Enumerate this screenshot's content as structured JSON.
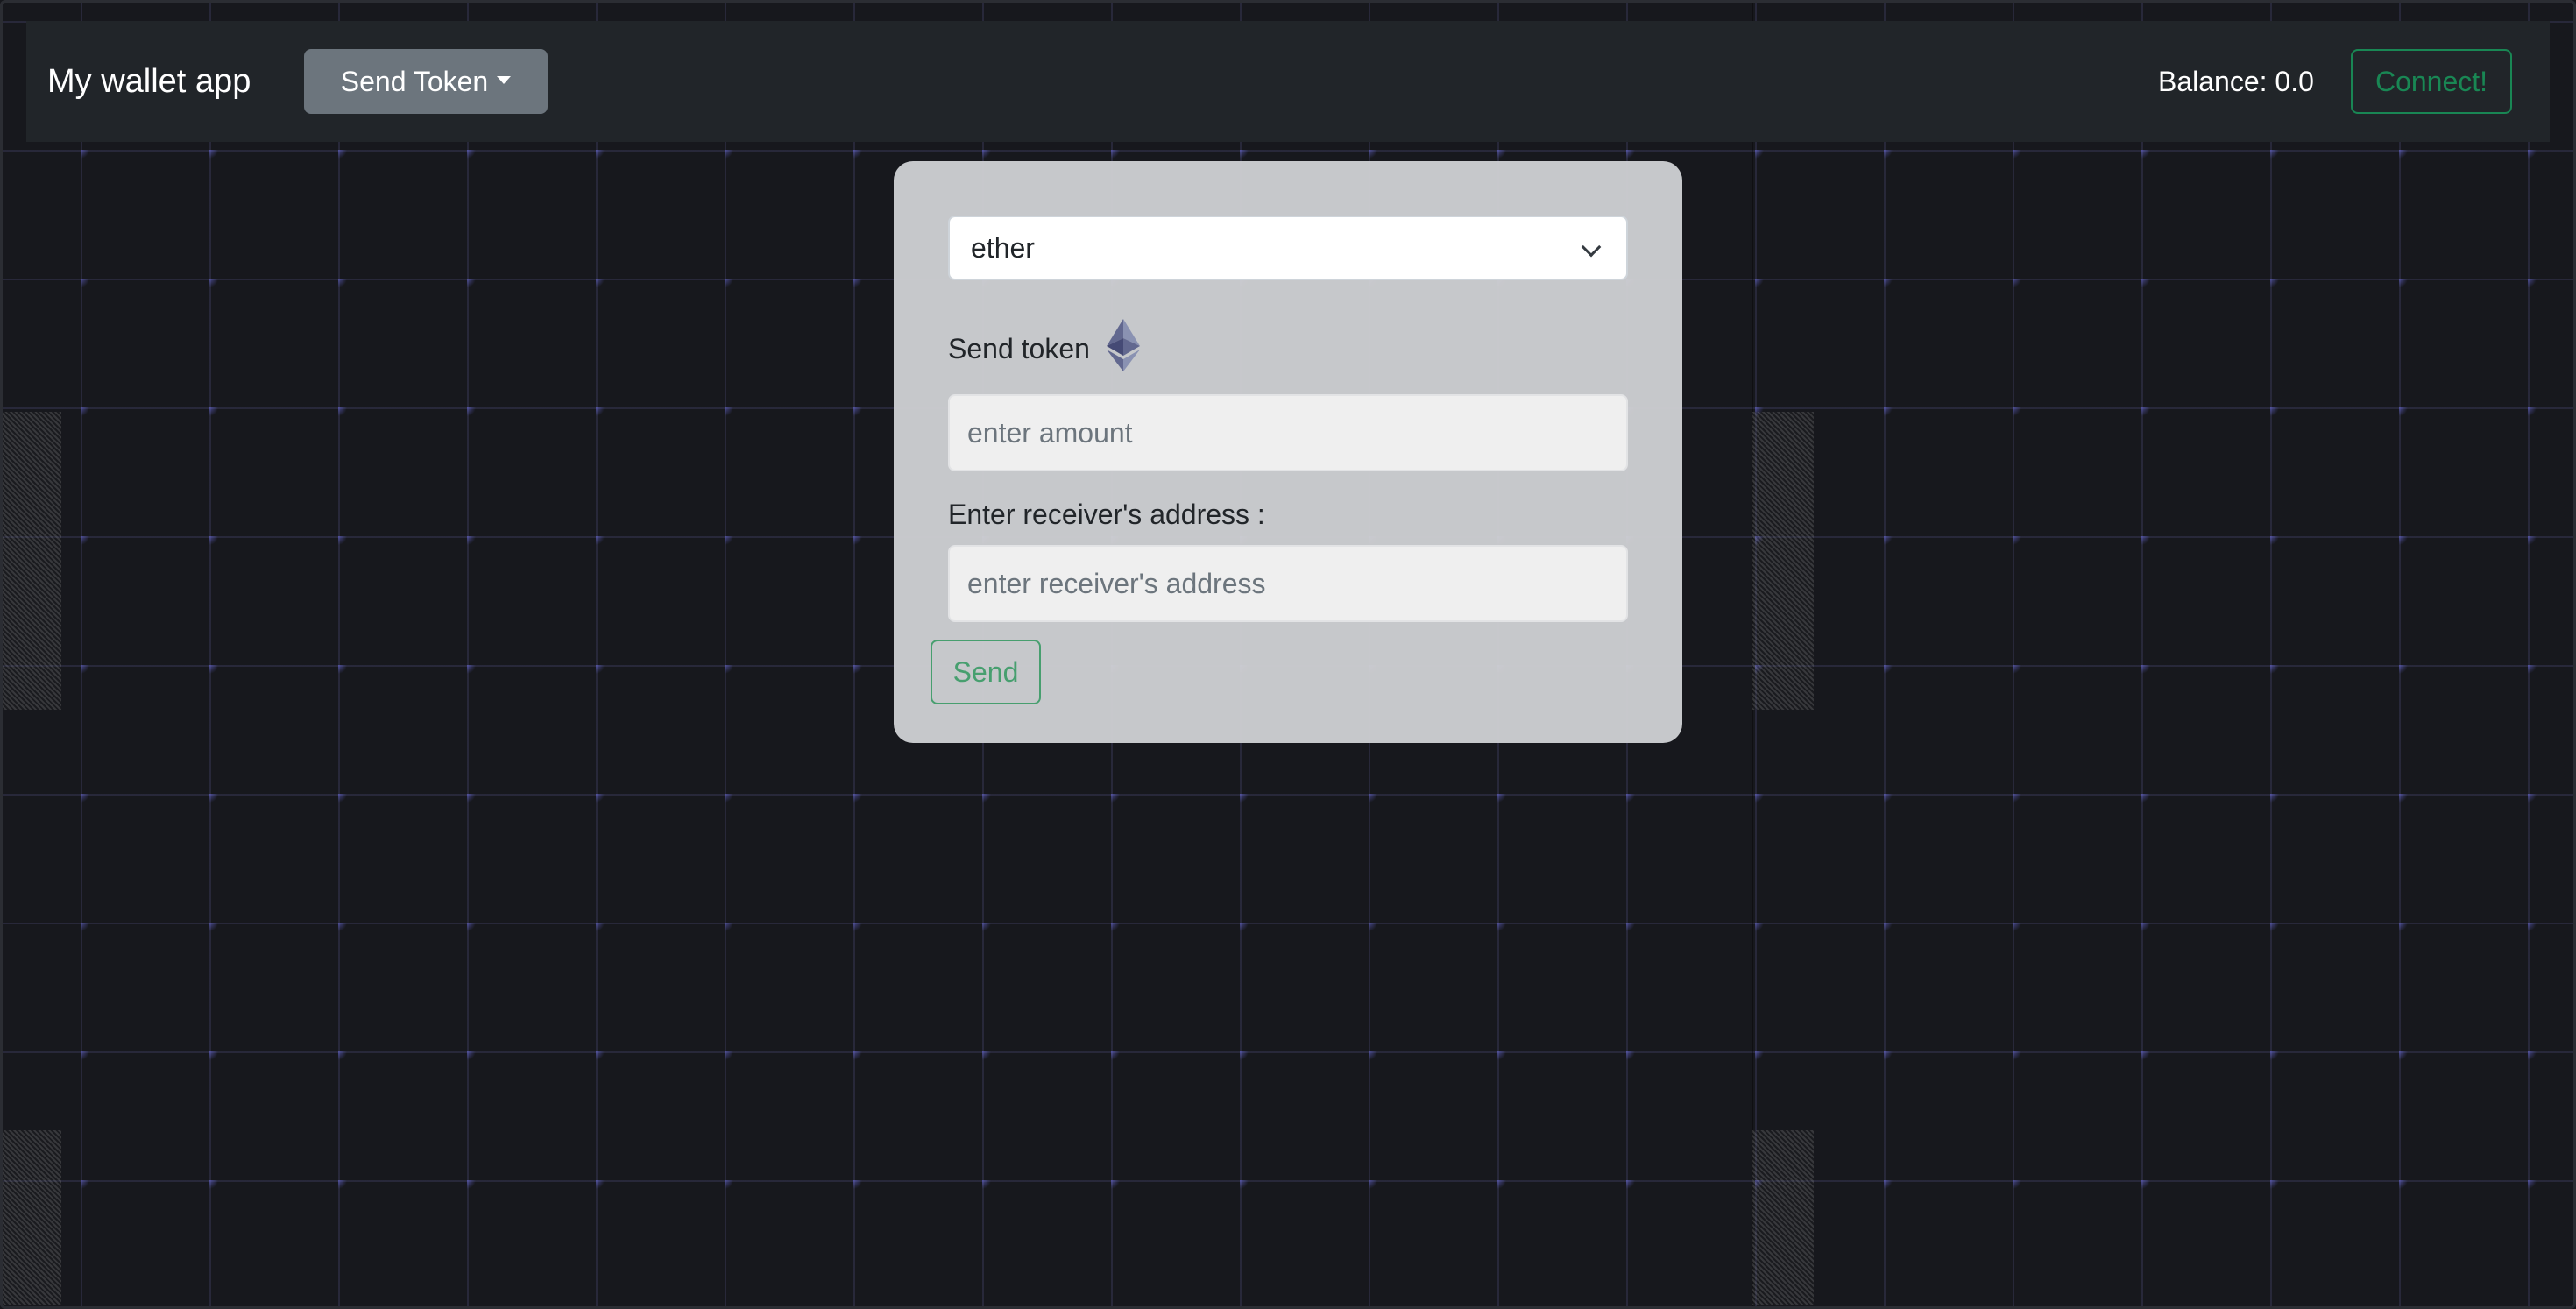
{
  "navbar": {
    "brand": "My wallet app",
    "dropdown_label": "Send Token",
    "balance": "Balance: 0.0",
    "connect_label": "Connect!"
  },
  "form": {
    "token_select": {
      "selected": "ether"
    },
    "send_token_label": "Send token",
    "token_icon": "ethereum-icon",
    "amount": {
      "value": "",
      "placeholder": "enter amount"
    },
    "receiver_label": "Enter receiver's address :",
    "receiver": {
      "value": "",
      "placeholder": "enter receiver's address"
    },
    "send_label": "Send"
  },
  "colors": {
    "navbar_bg": "#212529",
    "secondary_button": "#6c757d",
    "success": "#198754",
    "card_bg": "#cecfd2",
    "page_bg": "#17181d"
  }
}
